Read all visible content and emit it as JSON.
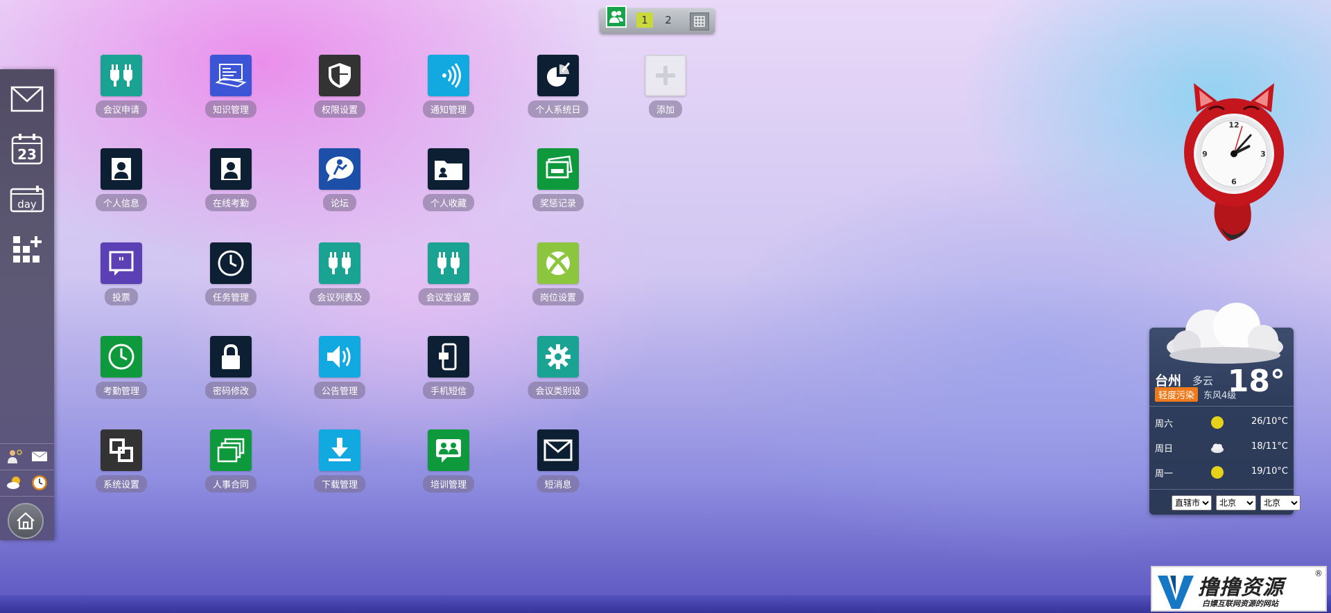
{
  "topbar": {
    "pages": [
      "1",
      "2"
    ],
    "active_page": "1",
    "icons": {
      "user": "users-icon",
      "grid": "grid-icon"
    }
  },
  "dock": {
    "items": [
      {
        "name": "mail",
        "icon": "envelope-icon"
      },
      {
        "name": "calendar",
        "icon": "calendar-icon",
        "day": "23"
      },
      {
        "name": "day-view",
        "icon": "day-icon",
        "text": "day"
      },
      {
        "name": "add-module",
        "icon": "blocks-add-icon"
      }
    ],
    "mini_items": [
      "user-settings-icon",
      "mail-icon",
      "weather-icon",
      "clock-icon"
    ],
    "home_icon": "home-icon"
  },
  "apps": [
    {
      "label": "会议申请",
      "color": "#1aa292",
      "icon": "plug-icon"
    },
    {
      "label": "知识管理",
      "color": "#3b55d6",
      "icon": "book-icon"
    },
    {
      "label": "权限设置",
      "color": "#333333",
      "icon": "shield-icon"
    },
    {
      "label": "通知管理",
      "color": "#12a9e0",
      "icon": "broadcast-icon"
    },
    {
      "label": "个人系统日",
      "color": "#0d1f33",
      "icon": "chart-pen-icon"
    },
    {
      "label": "添加",
      "color": "#ececf0",
      "icon": "plus-icon"
    },
    {
      "label": "个人信息",
      "color": "#0d1f33",
      "icon": "person-icon"
    },
    {
      "label": "在线考勤",
      "color": "#0d1f33",
      "icon": "person-icon"
    },
    {
      "label": "论坛",
      "color": "#1b4fa8",
      "icon": "forum-icon"
    },
    {
      "label": "个人收藏",
      "color": "#0d1f33",
      "icon": "folder-icon"
    },
    {
      "label": "奖惩记录",
      "color": "#0e9a3c",
      "icon": "cards-icon"
    },
    {
      "label": "投票",
      "color": "#5b3fb5",
      "icon": "quote-bubble-icon"
    },
    {
      "label": "任务管理",
      "color": "#0d1f33",
      "icon": "clock-icon"
    },
    {
      "label": "会议列表及",
      "color": "#1aa292",
      "icon": "plug-icon"
    },
    {
      "label": "会议室设置",
      "color": "#1aa292",
      "icon": "plug-icon"
    },
    {
      "label": "岗位设置",
      "color": "#8cc63f",
      "icon": "xbox-icon"
    },
    {
      "label": "考勤管理",
      "color": "#0e9a3c",
      "icon": "clock-icon"
    },
    {
      "label": "密码修改",
      "color": "#0d1f33",
      "icon": "lock-icon"
    },
    {
      "label": "公告管理",
      "color": "#12a9e0",
      "icon": "speaker-icon"
    },
    {
      "label": "手机短信",
      "color": "#0d1f33",
      "icon": "phone-icon"
    },
    {
      "label": "会议类别设",
      "color": "#1aa292",
      "icon": "gear-icon"
    },
    {
      "label": "系统设置",
      "color": "#333333",
      "icon": "windows-icon"
    },
    {
      "label": "人事合同",
      "color": "#0e9a3c",
      "icon": "stack-icon"
    },
    {
      "label": "下载管理",
      "color": "#12a9e0",
      "icon": "download-icon"
    },
    {
      "label": "培训管理",
      "color": "#0e9a3c",
      "icon": "group-icon"
    },
    {
      "label": "短消息",
      "color": "#0d1f33",
      "icon": "envelope-icon"
    }
  ],
  "clock": {
    "numbers": [
      "12",
      "3",
      "6",
      "9"
    ],
    "hour": 2,
    "minute": 7
  },
  "weather": {
    "city": "台州",
    "condition": "多云",
    "temp": "18°",
    "aqi": "轻度污染",
    "wind": "东风4级",
    "forecast": [
      {
        "day": "周六",
        "icon": "sun-icon",
        "range": "26/10°C"
      },
      {
        "day": "周日",
        "icon": "cloud-icon",
        "range": "18/11°C"
      },
      {
        "day": "周一",
        "icon": "sun-icon",
        "range": "19/10°C"
      }
    ],
    "selects": {
      "s1": "直辖市",
      "s2": "北京",
      "s3": "北京"
    }
  },
  "logo": {
    "brand": "撸撸资源",
    "slogan": "白嫖互联网资源的网站",
    "reg": "®"
  }
}
